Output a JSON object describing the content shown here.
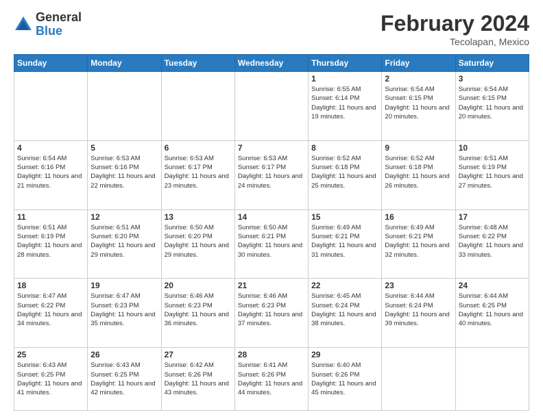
{
  "logo": {
    "general": "General",
    "blue": "Blue"
  },
  "header": {
    "month_year": "February 2024",
    "location": "Tecolapan, Mexico"
  },
  "weekdays": [
    "Sunday",
    "Monday",
    "Tuesday",
    "Wednesday",
    "Thursday",
    "Friday",
    "Saturday"
  ],
  "weeks": [
    [
      {
        "day": "",
        "info": ""
      },
      {
        "day": "",
        "info": ""
      },
      {
        "day": "",
        "info": ""
      },
      {
        "day": "",
        "info": ""
      },
      {
        "day": "1",
        "info": "Sunrise: 6:55 AM\nSunset: 6:14 PM\nDaylight: 11 hours and 19 minutes."
      },
      {
        "day": "2",
        "info": "Sunrise: 6:54 AM\nSunset: 6:15 PM\nDaylight: 11 hours and 20 minutes."
      },
      {
        "day": "3",
        "info": "Sunrise: 6:54 AM\nSunset: 6:15 PM\nDaylight: 11 hours and 20 minutes."
      }
    ],
    [
      {
        "day": "4",
        "info": "Sunrise: 6:54 AM\nSunset: 6:16 PM\nDaylight: 11 hours and 21 minutes."
      },
      {
        "day": "5",
        "info": "Sunrise: 6:53 AM\nSunset: 6:16 PM\nDaylight: 11 hours and 22 minutes."
      },
      {
        "day": "6",
        "info": "Sunrise: 6:53 AM\nSunset: 6:17 PM\nDaylight: 11 hours and 23 minutes."
      },
      {
        "day": "7",
        "info": "Sunrise: 6:53 AM\nSunset: 6:17 PM\nDaylight: 11 hours and 24 minutes."
      },
      {
        "day": "8",
        "info": "Sunrise: 6:52 AM\nSunset: 6:18 PM\nDaylight: 11 hours and 25 minutes."
      },
      {
        "day": "9",
        "info": "Sunrise: 6:52 AM\nSunset: 6:18 PM\nDaylight: 11 hours and 26 minutes."
      },
      {
        "day": "10",
        "info": "Sunrise: 6:51 AM\nSunset: 6:19 PM\nDaylight: 11 hours and 27 minutes."
      }
    ],
    [
      {
        "day": "11",
        "info": "Sunrise: 6:51 AM\nSunset: 6:19 PM\nDaylight: 11 hours and 28 minutes."
      },
      {
        "day": "12",
        "info": "Sunrise: 6:51 AM\nSunset: 6:20 PM\nDaylight: 11 hours and 29 minutes."
      },
      {
        "day": "13",
        "info": "Sunrise: 6:50 AM\nSunset: 6:20 PM\nDaylight: 11 hours and 29 minutes."
      },
      {
        "day": "14",
        "info": "Sunrise: 6:50 AM\nSunset: 6:21 PM\nDaylight: 11 hours and 30 minutes."
      },
      {
        "day": "15",
        "info": "Sunrise: 6:49 AM\nSunset: 6:21 PM\nDaylight: 11 hours and 31 minutes."
      },
      {
        "day": "16",
        "info": "Sunrise: 6:49 AM\nSunset: 6:21 PM\nDaylight: 11 hours and 32 minutes."
      },
      {
        "day": "17",
        "info": "Sunrise: 6:48 AM\nSunset: 6:22 PM\nDaylight: 11 hours and 33 minutes."
      }
    ],
    [
      {
        "day": "18",
        "info": "Sunrise: 6:47 AM\nSunset: 6:22 PM\nDaylight: 11 hours and 34 minutes."
      },
      {
        "day": "19",
        "info": "Sunrise: 6:47 AM\nSunset: 6:23 PM\nDaylight: 11 hours and 35 minutes."
      },
      {
        "day": "20",
        "info": "Sunrise: 6:46 AM\nSunset: 6:23 PM\nDaylight: 11 hours and 36 minutes."
      },
      {
        "day": "21",
        "info": "Sunrise: 6:46 AM\nSunset: 6:23 PM\nDaylight: 11 hours and 37 minutes."
      },
      {
        "day": "22",
        "info": "Sunrise: 6:45 AM\nSunset: 6:24 PM\nDaylight: 11 hours and 38 minutes."
      },
      {
        "day": "23",
        "info": "Sunrise: 6:44 AM\nSunset: 6:24 PM\nDaylight: 11 hours and 39 minutes."
      },
      {
        "day": "24",
        "info": "Sunrise: 6:44 AM\nSunset: 6:25 PM\nDaylight: 11 hours and 40 minutes."
      }
    ],
    [
      {
        "day": "25",
        "info": "Sunrise: 6:43 AM\nSunset: 6:25 PM\nDaylight: 11 hours and 41 minutes."
      },
      {
        "day": "26",
        "info": "Sunrise: 6:43 AM\nSunset: 6:25 PM\nDaylight: 11 hours and 42 minutes."
      },
      {
        "day": "27",
        "info": "Sunrise: 6:42 AM\nSunset: 6:26 PM\nDaylight: 11 hours and 43 minutes."
      },
      {
        "day": "28",
        "info": "Sunrise: 6:41 AM\nSunset: 6:26 PM\nDaylight: 11 hours and 44 minutes."
      },
      {
        "day": "29",
        "info": "Sunrise: 6:40 AM\nSunset: 6:26 PM\nDaylight: 11 hours and 45 minutes."
      },
      {
        "day": "",
        "info": ""
      },
      {
        "day": "",
        "info": ""
      }
    ]
  ]
}
